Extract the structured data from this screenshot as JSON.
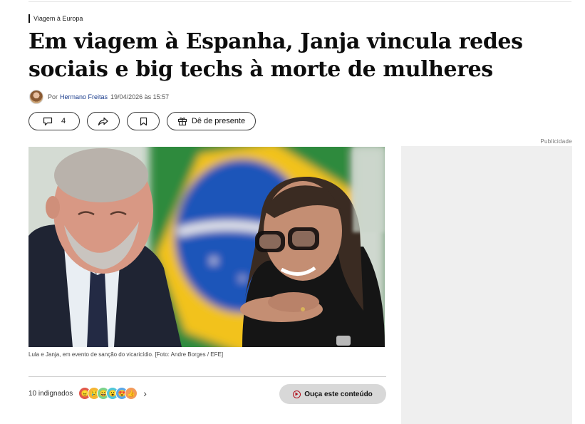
{
  "article": {
    "section": "Viagem à Europa",
    "headline": "Em viagem à Espanha, Janja vincula redes sociais e big techs à morte de mulheres",
    "byline_prefix": "Por",
    "author": "Hermano Freitas",
    "timestamp": "19/04/2026 às 15:57"
  },
  "actions": {
    "comment_count": "4",
    "gift_label": "Dê de presente"
  },
  "ad": {
    "label": "Publicidade"
  },
  "photo": {
    "caption": "Lula e Janja, em evento de sanção do vicaricídio. [Foto: Andre Borges / EFE]"
  },
  "reactions": {
    "summary": "10 indignados",
    "icons": [
      "angry-icon",
      "sad-icon",
      "laugh-icon",
      "surprise-icon",
      "love-icon",
      "like-icon"
    ],
    "colors": [
      "#e2584a",
      "#f5b533",
      "#7bd38a",
      "#4fc7d9",
      "#5aa7e8",
      "#f29a5a"
    ],
    "glyphs": [
      "😠",
      "😢",
      "😄",
      "😮",
      "😍",
      "👍"
    ]
  },
  "audio": {
    "label": "Ouça este conteúdo"
  },
  "colors": {
    "link": "#1a3c8c",
    "play_accent": "#b3121f",
    "ad_bg": "#efefef"
  }
}
